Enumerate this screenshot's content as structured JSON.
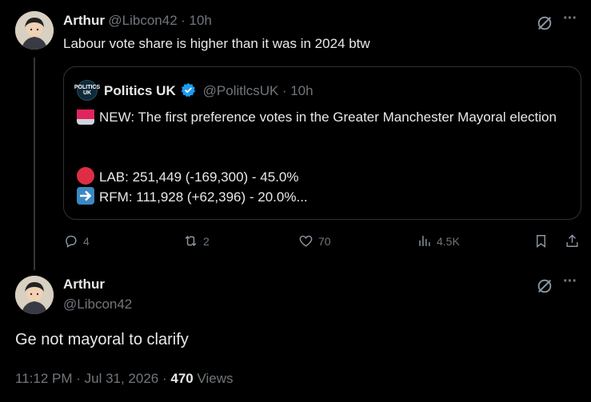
{
  "reply_tweet": {
    "author_name": "Arthur",
    "author_handle": "@Libcon42",
    "time": "· 10h",
    "text": "Labour vote share is higher than it was in 2024 btw"
  },
  "quoted_tweet": {
    "author_name": "Politics UK",
    "avatar_label": "POLITICS UK",
    "author_handle": "@PolitlcsUK",
    "time": "· 10h",
    "line1": "NEW: The first preference votes in the Greater Manchester Mayoral election",
    "line2": "LAB: 251,449 (-169,300) - 45.0%",
    "line3": "RFM: 111,928 (+62,396) - 20.0%..."
  },
  "actions": {
    "replies": "4",
    "reposts": "2",
    "likes": "70",
    "views": "4.5K"
  },
  "main_tweet": {
    "author_name": "Arthur",
    "author_handle": "@Libcon42",
    "text": "Ge not mayoral to clarify",
    "timestamp": "11:12 PM · Jul 31, 2026 ·",
    "views_count": "470",
    "views_label": "Views"
  },
  "more_icon_label": "···",
  "colors": {
    "background": "#000000",
    "text": "#e7e9ea",
    "muted": "#71767b",
    "verified": "#1d9bf0",
    "lab_dot": "#e0245e",
    "rfm_arrow": "#3b88c3"
  }
}
